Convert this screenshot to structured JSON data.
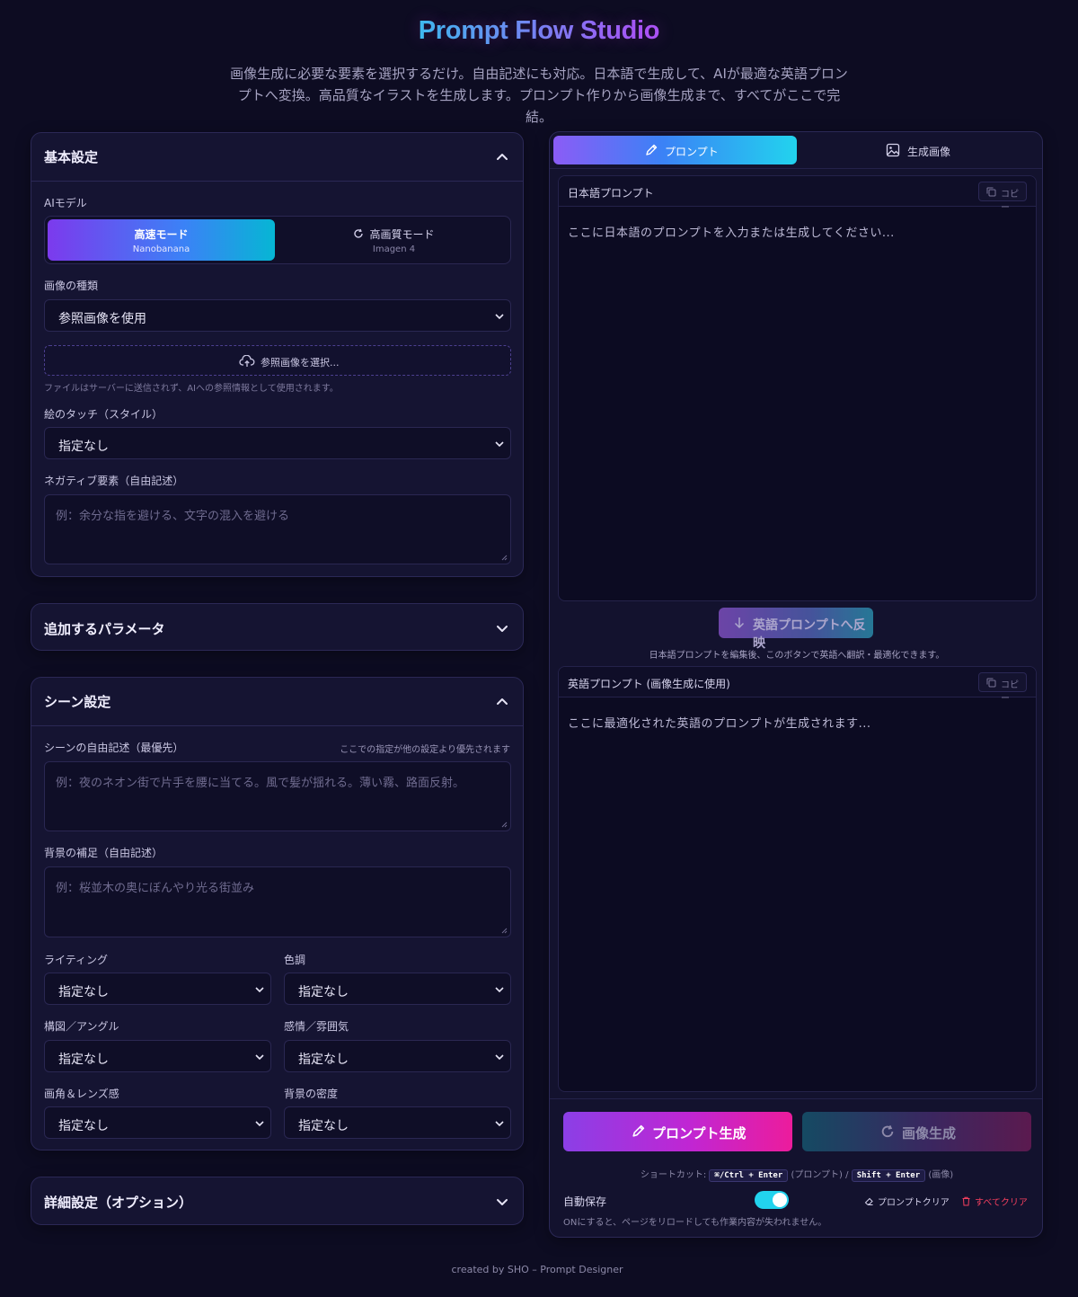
{
  "header": {
    "title": "Prompt Flow Studio",
    "description": "画像生成に必要な要素を選択するだけ。自由記述にも対応。日本語で生成して、AIが最適な英語プロンプトへ変換。高品質なイラストを生成します。プロンプト作りから画像生成まで、すべてがここで完結。"
  },
  "basic": {
    "title": "基本設定",
    "ai_model_label": "AIモデル",
    "mode_fast": {
      "title": "高速モード",
      "sub": "Nanobanana"
    },
    "mode_quality": {
      "title": "高画質モード",
      "sub": "Imagen 4"
    },
    "image_type_label": "画像の種類",
    "image_type_value": "参照画像を使用",
    "upload_label": "参照画像を選択...",
    "upload_note": "ファイルはサーバーに送信されず、AIへの参照情報として使用されます。",
    "style_label": "絵のタッチ（スタイル）",
    "style_value": "指定なし",
    "negative_label": "ネガティブ要素（自由記述）",
    "negative_placeholder": "例：余分な指を避ける、文字の混入を避ける"
  },
  "params": {
    "title": "追加するパラメータ"
  },
  "scene": {
    "title": "シーン設定",
    "free_label": "シーンの自由記述（最優先）",
    "free_hint": "ここでの指定が他の設定より優先されます",
    "free_placeholder": "例：夜のネオン街で片手を腰に当てる。風で髪が揺れる。薄い霧、路面反射。",
    "bg_label": "背景の補足（自由記述）",
    "bg_placeholder": "例：桜並木の奥にぼんやり光る街並み",
    "lighting_label": "ライティング",
    "lighting_value": "指定なし",
    "tone_label": "色調",
    "tone_value": "指定なし",
    "composition_label": "構図／アングル",
    "composition_value": "指定なし",
    "emotion_label": "感情／雰囲気",
    "emotion_value": "指定なし",
    "lens_label": "画角＆レンズ感",
    "lens_value": "指定なし",
    "density_label": "背景の密度",
    "density_value": "指定なし"
  },
  "advanced": {
    "title": "詳細設定（オプション）"
  },
  "right": {
    "tab_prompt": "プロンプト",
    "tab_image": "生成画像",
    "jp_title": "日本語プロンプト",
    "jp_placeholder": "ここに日本語のプロンプトを入力または生成してください...",
    "copy_label": "コピー",
    "reflect_label": "英語プロンプトへ反映",
    "reflect_note": "日本語プロンプトを編集後、このボタンで英語へ翻訳・最適化できます。",
    "en_title": "英語プロンプト (画像生成に使用)",
    "en_placeholder": "ここに最適化された英語のプロンプトが生成されます...",
    "gen_prompt_label": "プロンプト生成",
    "gen_image_label": "画像生成",
    "shortcut_prefix": "ショートカット:",
    "shortcut_prompt_key": "⌘/Ctrl + Enter",
    "shortcut_prompt_suffix": "(プロンプト) /",
    "shortcut_image_key": "Shift + Enter",
    "shortcut_image_suffix": "(画像)",
    "autosave_label": "自動保存",
    "autosave_on": true,
    "clear_prompt_label": "プロンプトクリア",
    "clear_all_label": "すべてクリア",
    "autosave_note": "ONにすると、ページをリロードしても作業内容が失われません。"
  },
  "footer": {
    "text": "created by SHO – Prompt Designer"
  },
  "colors": {
    "background": "#0d0c22",
    "panel": "#151432",
    "accent_cyan": "#22d3ee",
    "accent_purple": "#8b5cf6",
    "accent_pink": "#ec4899",
    "danger": "#f43f5e"
  }
}
